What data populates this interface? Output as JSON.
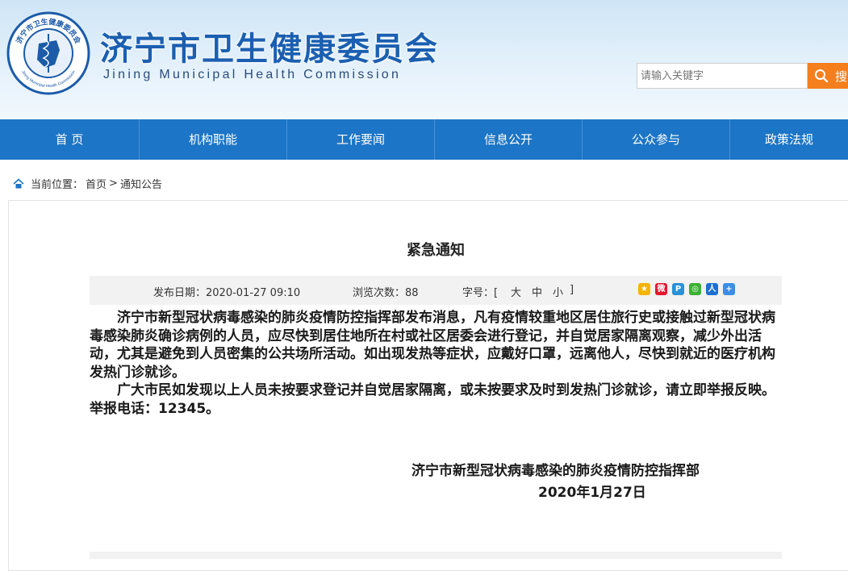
{
  "header": {
    "title": "济宁市卫生健康委员会",
    "subtitle": "Jining Municipal Health Commission",
    "emblem_text_cn": "济宁市卫生健康委员会",
    "emblem_text_en": "Jining Municipal Health Commission"
  },
  "search": {
    "placeholder": "请输入关键字",
    "button_label": "搜",
    "icon": "search-icon"
  },
  "nav": {
    "items": [
      "首 页",
      "机构职能",
      "工作要闻",
      "信息公开",
      "公众参与",
      "政策法规"
    ]
  },
  "breadcrumb": {
    "icon": "home-icon",
    "prefix": "当前位置：",
    "home": "首页",
    "separator": ">",
    "current": "通知公告"
  },
  "article": {
    "title": "紧急通知",
    "publish_date": "发布日期：2020-01-27 09:10",
    "views": "浏览次数：88",
    "font_size_label": "字号：[",
    "font_large": "大",
    "font_medium": "中",
    "font_small": "小",
    "font_size_close": "]",
    "share_icons": [
      "qzone-icon",
      "weibo-icon",
      "tencent-weibo-icon",
      "wechat-icon",
      "renren-icon",
      "more-share-icon"
    ],
    "paragraphs": [
      "济宁市新型冠状病毒感染的肺炎疫情防控指挥部发布消息，凡有疫情较重地区居住旅行史或接触过新型冠状病毒感染肺炎确诊病例的人员，应尽快到居住地所在村或社区居委会进行登记，并自觉居家隔离观察，减少外出活动，尤其是避免到人员密集的公共场所活动。如出现发热等症状，应戴好口罩，远离他人，尽快到就近的医疗机构发热门诊就诊。",
      "广大市民如发现以上人员未按要求登记并自觉居家隔离，或未按要求及时到发热门诊就诊，请立即举报反映。举报电话：12345。"
    ],
    "signature": "济宁市新型冠状病毒感染的肺炎疫情防控指挥部",
    "date": "2020年1月27日"
  },
  "colors": {
    "nav_bg": "#1c75c6",
    "title_blue": "#1b5fb0",
    "search_button": "#f57f1c"
  }
}
